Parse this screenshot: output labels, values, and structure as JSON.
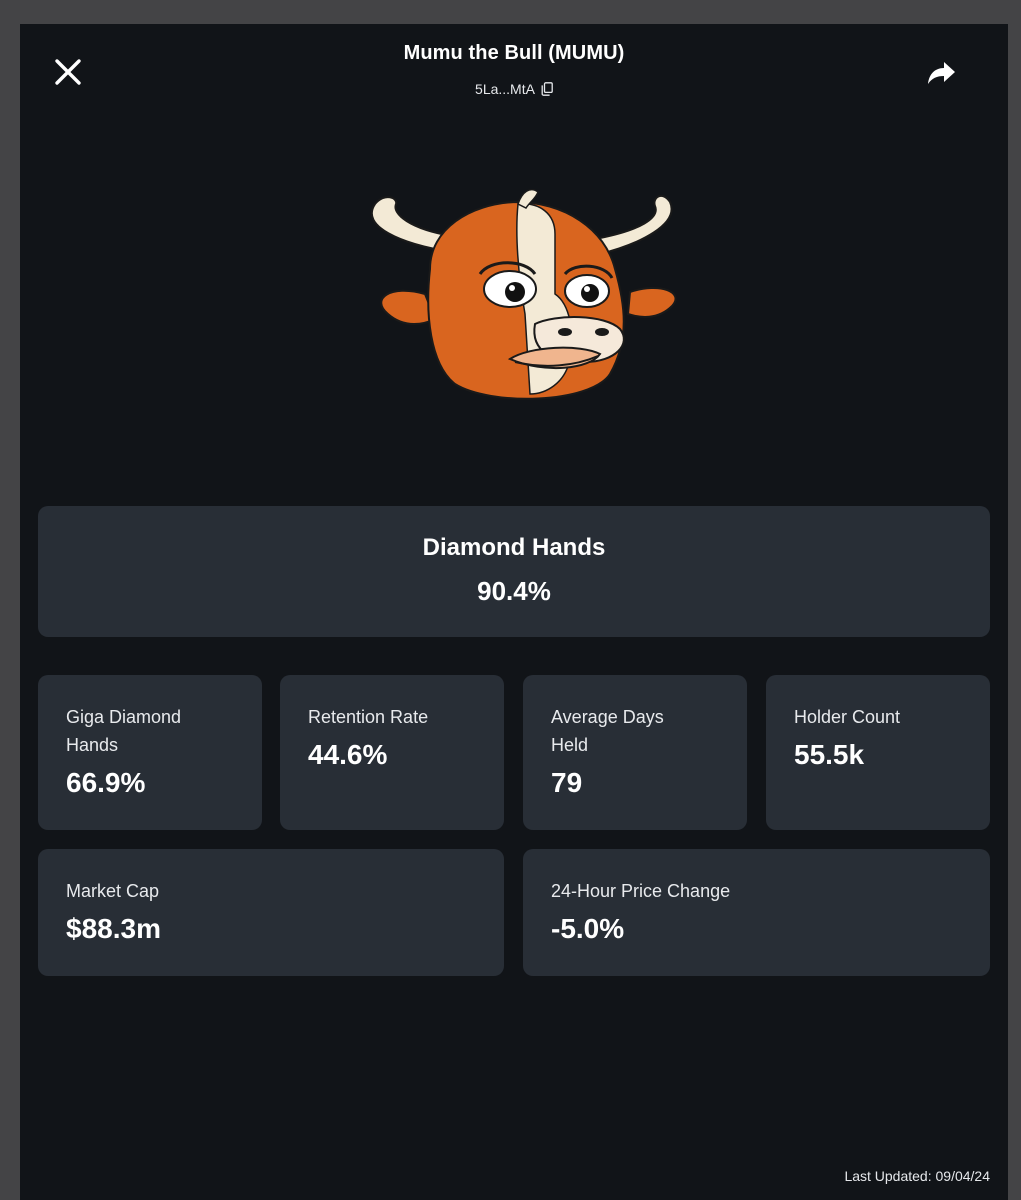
{
  "header": {
    "title": "Mumu the Bull (MUMU)",
    "address": "5La...MtA",
    "close_icon": "close-icon",
    "share_icon": "share-icon",
    "copy_icon": "copy-icon"
  },
  "token_logo": {
    "icon": "bull-mascot-logo"
  },
  "hero_stat": {
    "label": "Diamond Hands",
    "value": "90.4%"
  },
  "stats": [
    {
      "label": "Giga Diamond Hands",
      "value": "66.9%"
    },
    {
      "label": "Retention Rate",
      "value": "44.6%"
    },
    {
      "label": "Average Days Held",
      "value": "79"
    },
    {
      "label": "Holder Count",
      "value": "55.5k"
    },
    {
      "label": "Market Cap",
      "value": "$88.3m"
    },
    {
      "label": "24-Hour Price Change",
      "value": "-5.0%"
    }
  ],
  "footer": {
    "last_updated": "Last Updated: 09/04/24"
  },
  "colors": {
    "page_background": "#111418",
    "card_background": "#282e36",
    "logo_orange": "#d9651f",
    "logo_cream": "#f3ead6"
  }
}
